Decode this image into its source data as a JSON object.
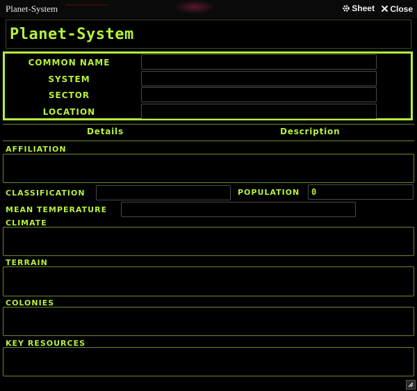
{
  "window": {
    "title": "Planet-System",
    "sheet_label": "Sheet",
    "close_label": "Close"
  },
  "sheet": {
    "title": "Planet-System"
  },
  "identity": {
    "common_name": {
      "label": "COMMON NAME",
      "value": ""
    },
    "system": {
      "label": "SYSTEM",
      "value": ""
    },
    "sector": {
      "label": "SECTOR",
      "value": ""
    },
    "location": {
      "label": "LOCATION",
      "value": ""
    }
  },
  "tabs": [
    {
      "label": "Details"
    },
    {
      "label": "Description"
    }
  ],
  "details": {
    "affiliation": {
      "label": "AFFILIATION",
      "value": ""
    },
    "classification": {
      "label": "CLASSIFICATION",
      "value": ""
    },
    "population": {
      "label": "POPULATION",
      "value": "0"
    },
    "mean_temperature": {
      "label": "MEAN TEMPERATURE",
      "value": ""
    },
    "climate": {
      "label": "CLIMATE",
      "value": ""
    },
    "terrain": {
      "label": "TERRAIN",
      "value": ""
    },
    "colonies": {
      "label": "COLONIES",
      "value": ""
    },
    "key_resources": {
      "label": "KEY RESOURCES",
      "value": ""
    }
  },
  "colors": {
    "accent": "#b6f23c",
    "background": "#000000",
    "border_dim": "#6c8a2a"
  },
  "icons": {
    "sheet": "gear-icon",
    "close": "close-icon",
    "resize": "resize-icon"
  }
}
